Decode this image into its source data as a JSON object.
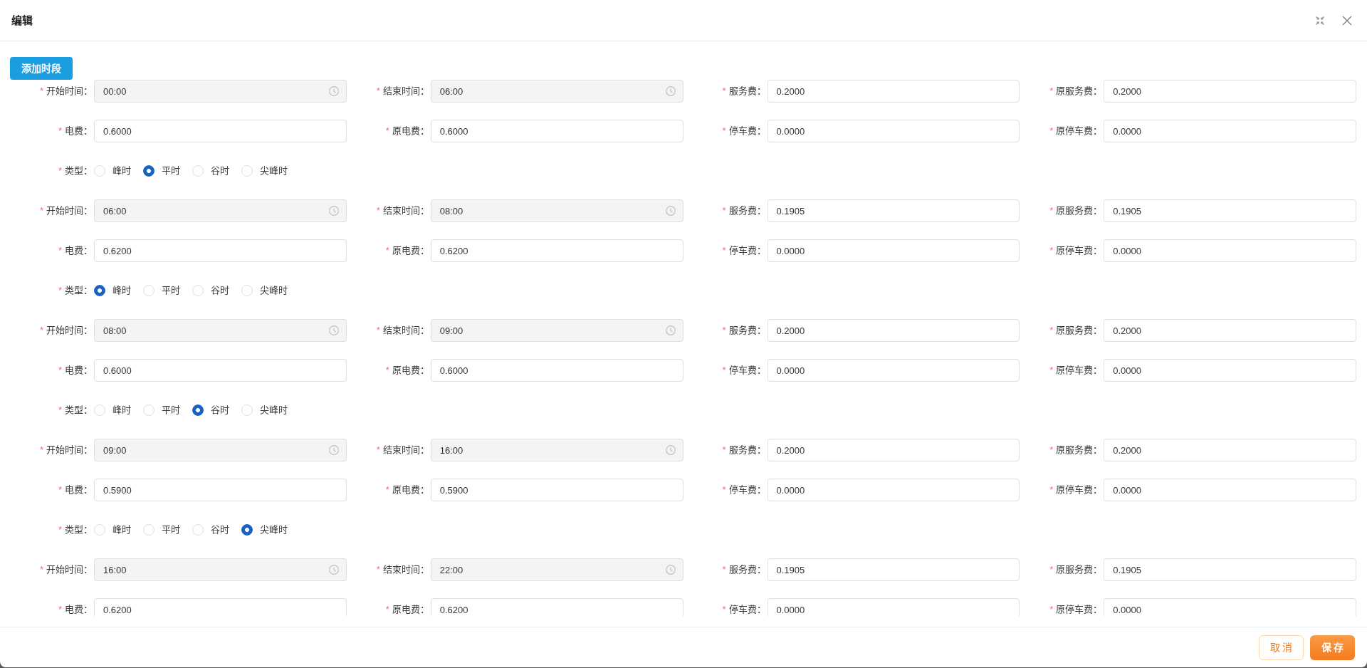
{
  "dialog": {
    "title": "编辑"
  },
  "add_button": {
    "label": "添加时段"
  },
  "periods": [
    {
      "fields": [
        {
          "kind": "time",
          "mark": "*",
          "label": "开始时间：",
          "value": "00:00"
        },
        {
          "kind": "time",
          "mark": "*",
          "label": "结束时间：",
          "value": "06:00"
        },
        {
          "kind": "text",
          "mark": "*",
          "label": "服务费：",
          "value": "0.2000"
        },
        {
          "kind": "text",
          "mark": "*",
          "label": "原服务费：",
          "value": "0.2000"
        },
        {
          "kind": "text",
          "mark": "*",
          "label": "电费：",
          "value": "0.6000"
        },
        {
          "kind": "text",
          "mark": "*",
          "label": "原电费：",
          "value": "0.6000"
        },
        {
          "kind": "text",
          "mark": "*",
          "label": "停车费：",
          "value": "0.0000"
        },
        {
          "kind": "text",
          "mark": "*",
          "label": "原停车费：",
          "value": "0.0000"
        }
      ],
      "type": {
        "mark": "*",
        "label": "类型：",
        "options": [
          {
            "label": "峰时",
            "selected": false
          },
          {
            "label": "平时",
            "selected": true
          },
          {
            "label": "谷时",
            "selected": false
          },
          {
            "label": "尖峰时",
            "selected": false
          }
        ]
      }
    },
    {
      "fields": [
        {
          "kind": "time",
          "mark": "*",
          "label": "开始时间：",
          "value": "06:00"
        },
        {
          "kind": "time",
          "mark": "*",
          "label": "结束时间：",
          "value": "08:00"
        },
        {
          "kind": "text",
          "mark": "*",
          "label": "服务费：",
          "value": "0.1905"
        },
        {
          "kind": "text",
          "mark": "*",
          "label": "原服务费：",
          "value": "0.1905"
        },
        {
          "kind": "text",
          "mark": "*",
          "label": "电费：",
          "value": "0.6200"
        },
        {
          "kind": "text",
          "mark": "*",
          "label": "原电费：",
          "value": "0.6200"
        },
        {
          "kind": "text",
          "mark": "*",
          "label": "停车费：",
          "value": "0.0000"
        },
        {
          "kind": "text",
          "mark": "*",
          "label": "原停车费：",
          "value": "0.0000"
        }
      ],
      "type": {
        "mark": "*",
        "label": "类型：",
        "options": [
          {
            "label": "峰时",
            "selected": true
          },
          {
            "label": "平时",
            "selected": false
          },
          {
            "label": "谷时",
            "selected": false
          },
          {
            "label": "尖峰时",
            "selected": false
          }
        ]
      }
    },
    {
      "fields": [
        {
          "kind": "time",
          "mark": "*",
          "label": "开始时间：",
          "value": "08:00"
        },
        {
          "kind": "time",
          "mark": "*",
          "label": "结束时间：",
          "value": "09:00"
        },
        {
          "kind": "text",
          "mark": "*",
          "label": "服务费：",
          "value": "0.2000"
        },
        {
          "kind": "text",
          "mark": "*",
          "label": "原服务费：",
          "value": "0.2000"
        },
        {
          "kind": "text",
          "mark": "*",
          "label": "电费：",
          "value": "0.6000"
        },
        {
          "kind": "text",
          "mark": "*",
          "label": "原电费：",
          "value": "0.6000"
        },
        {
          "kind": "text",
          "mark": "*",
          "label": "停车费：",
          "value": "0.0000"
        },
        {
          "kind": "text",
          "mark": "*",
          "label": "原停车费：",
          "value": "0.0000"
        }
      ],
      "type": {
        "mark": "*",
        "label": "类型：",
        "options": [
          {
            "label": "峰时",
            "selected": false
          },
          {
            "label": "平时",
            "selected": false
          },
          {
            "label": "谷时",
            "selected": true
          },
          {
            "label": "尖峰时",
            "selected": false
          }
        ]
      }
    },
    {
      "fields": [
        {
          "kind": "time",
          "mark": "*",
          "label": "开始时间：",
          "value": "09:00"
        },
        {
          "kind": "time",
          "mark": "*",
          "label": "结束时间：",
          "value": "16:00"
        },
        {
          "kind": "text",
          "mark": "*",
          "label": "服务费：",
          "value": "0.2000"
        },
        {
          "kind": "text",
          "mark": "*",
          "label": "原服务费：",
          "value": "0.2000"
        },
        {
          "kind": "text",
          "mark": "*",
          "label": "电费：",
          "value": "0.5900"
        },
        {
          "kind": "text",
          "mark": "*",
          "label": "原电费：",
          "value": "0.5900"
        },
        {
          "kind": "text",
          "mark": "*",
          "label": "停车费：",
          "value": "0.0000"
        },
        {
          "kind": "text",
          "mark": "*",
          "label": "原停车费：",
          "value": "0.0000"
        }
      ],
      "type": {
        "mark": "*",
        "label": "类型：",
        "options": [
          {
            "label": "峰时",
            "selected": false
          },
          {
            "label": "平时",
            "selected": false
          },
          {
            "label": "谷时",
            "selected": false
          },
          {
            "label": "尖峰时",
            "selected": true
          }
        ]
      }
    },
    {
      "fields": [
        {
          "kind": "time",
          "mark": "*",
          "label": "开始时间：",
          "value": "16:00"
        },
        {
          "kind": "time",
          "mark": "*",
          "label": "结束时间：",
          "value": "22:00"
        },
        {
          "kind": "text",
          "mark": "*",
          "label": "服务费：",
          "value": "0.1905"
        },
        {
          "kind": "text",
          "mark": "*",
          "label": "原服务费：",
          "value": "0.1905"
        },
        {
          "kind": "text",
          "mark": "*",
          "label": "电费：",
          "value": "0.6200"
        },
        {
          "kind": "text",
          "mark": "*",
          "label": "原电费：",
          "value": "0.6200"
        },
        {
          "kind": "text",
          "mark": "*",
          "label": "停车费：",
          "value": "0.0000"
        },
        {
          "kind": "text",
          "mark": "*",
          "label": "原停车费：",
          "value": "0.0000"
        }
      ]
    }
  ],
  "footer": {
    "buttons": [
      {
        "kind": "cancel",
        "label": "取 消"
      },
      {
        "kind": "primary",
        "label": "保 存"
      }
    ]
  }
}
